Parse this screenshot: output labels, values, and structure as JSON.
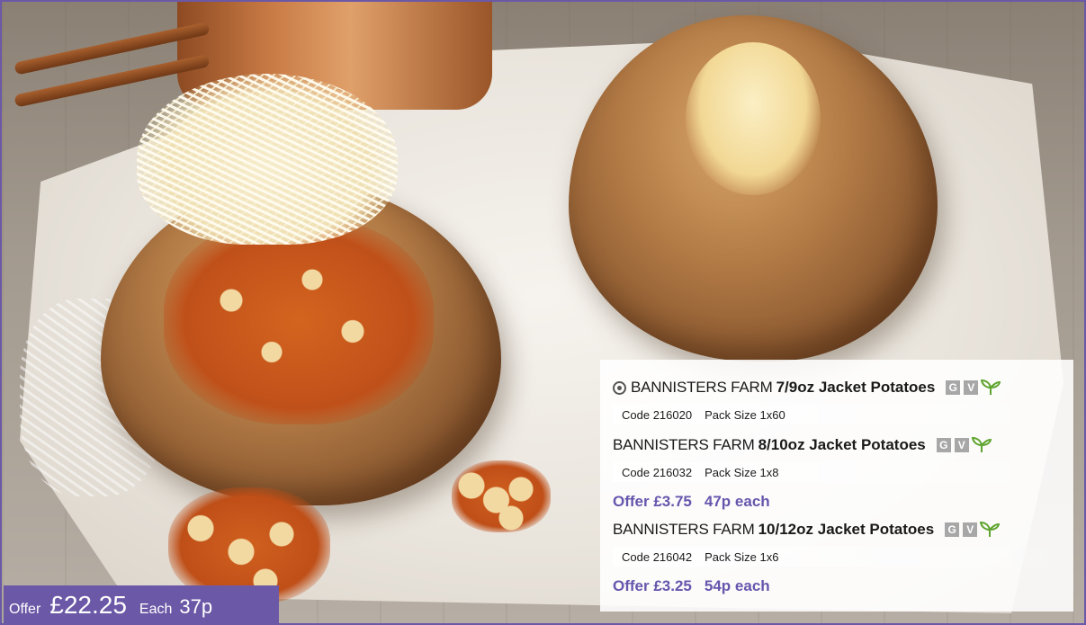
{
  "colors": {
    "accent_purple": "#6b58a6",
    "offer_text": "#6656ad",
    "badge_grey": "#a7a7a7",
    "vegan_green": "#5fa52f"
  },
  "image": {
    "icons": [
      "jacket-potato-with-beans-cheese",
      "plain-jacket-potato",
      "copper-pan"
    ]
  },
  "products": [
    {
      "brand": "BANNISTERS FARM",
      "name": "7/9oz Jacket Potatoes",
      "has_camera_icon": true,
      "badges": [
        "G",
        "V"
      ],
      "code_label": "Code 216020",
      "pack_label": "Pack Size 1x60"
    },
    {
      "brand": "BANNISTERS FARM",
      "name": "8/10oz Jacket Potatoes",
      "badges": [
        "G",
        "V"
      ],
      "code_label": "Code 216032",
      "pack_label": "Pack Size 1x8",
      "offer": "Offer £3.75",
      "each": "47p each"
    },
    {
      "brand": "BANNISTERS FARM",
      "name": "10/12oz Jacket Potatoes",
      "badges": [
        "G",
        "V"
      ],
      "code_label": "Code 216042",
      "pack_label": "Pack Size 1x6",
      "offer": "Offer £3.25",
      "each": "54p each"
    }
  ],
  "offer_tag": {
    "offer_label": "Offer",
    "offer_price": "£22.25",
    "each_label": "Each",
    "each_price": "37p"
  }
}
